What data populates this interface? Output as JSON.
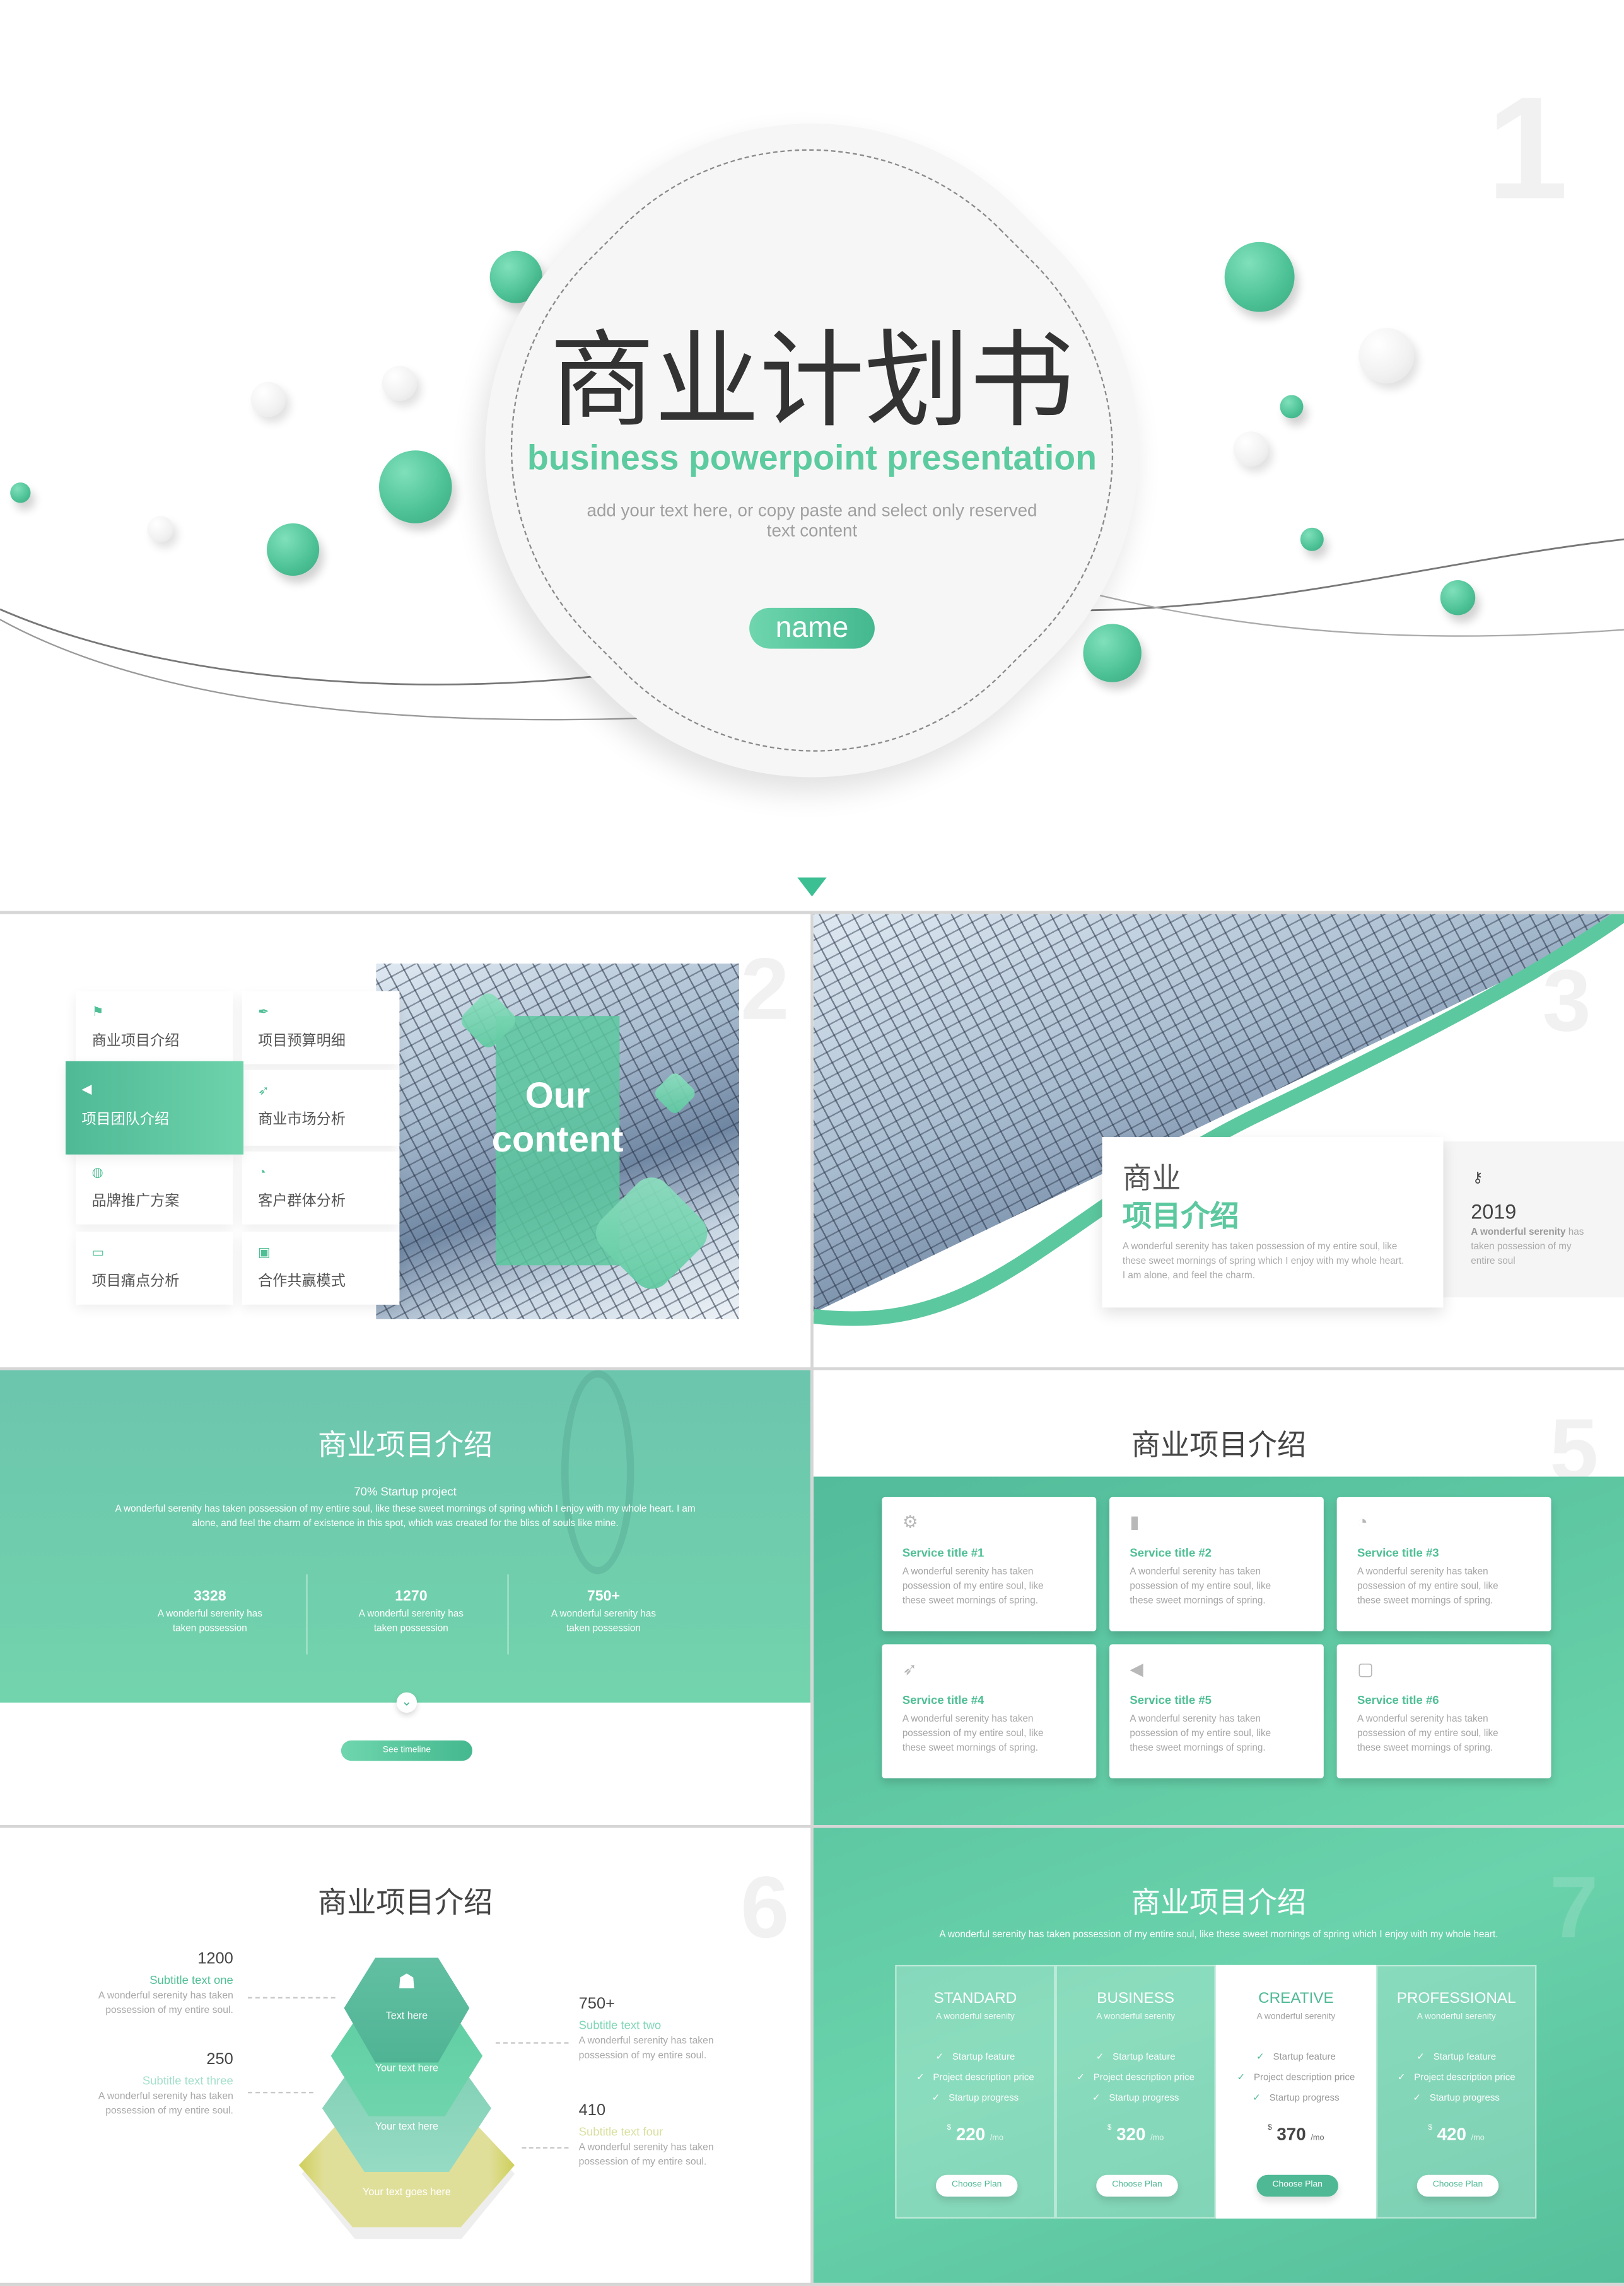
{
  "theme": {
    "accent": "#5cc89f",
    "accent_dark": "#4fb996",
    "yellow": "#e0df9a"
  },
  "slide1": {
    "title": "商业计划书",
    "subtitle": "business powerpoint presentation",
    "body_line1": "add your text here, or copy paste and select only reserved",
    "body_line2": "text content",
    "name_button": "name",
    "page_number": "1"
  },
  "slide2": {
    "page_number": "2",
    "overlay_title_1": "Our",
    "overlay_title_2": "content",
    "menu": [
      {
        "label": "商业项目介绍",
        "icon": "flag-icon"
      },
      {
        "label": "项目预算明细",
        "icon": "pen-icon"
      },
      {
        "label": "项目团队介绍",
        "icon": "megaphone-icon",
        "active": true
      },
      {
        "label": "商业市场分析",
        "icon": "rocket-icon"
      },
      {
        "label": "品牌推广方案",
        "icon": "globe-icon"
      },
      {
        "label": "客户群体分析",
        "icon": "pie-chart-icon"
      },
      {
        "label": "项目痛点分析",
        "icon": "credit-card-icon"
      },
      {
        "label": "合作共赢模式",
        "icon": "chart-icon"
      }
    ]
  },
  "slide3": {
    "page_number": "3",
    "title_1": "商业",
    "title_2": "项目介绍",
    "body": "A wonderful serenity has taken possession of my entire soul, like these sweet mornings of spring which I enjoy with my whole heart. I am alone, and feel the charm.",
    "year": "2019",
    "side_bold": "A wonderful serenity",
    "side_text": "has taken possession of my entire soul"
  },
  "slide4": {
    "title": "商业项目介绍",
    "tagline": "70% Startup project",
    "body": "A wonderful serenity has taken possession of my entire soul, like these sweet mornings of spring which I enjoy with my whole heart. I am alone, and feel the charm of existence in this spot, which was created for the bliss of souls like mine.",
    "stats": [
      {
        "value": "3328",
        "text": "A wonderful serenity has taken possession"
      },
      {
        "value": "1270",
        "text": "A wonderful serenity has taken possession"
      },
      {
        "value": "750+",
        "text": "A wonderful serenity has taken possession"
      }
    ],
    "button": "See timeline"
  },
  "slide5": {
    "title": "商业项目介绍",
    "page_number": "5",
    "services": [
      {
        "title": "Service title #1",
        "icon": "gear-icon",
        "text": "A wonderful serenity has taken possession of my entire soul, like these sweet mornings of spring."
      },
      {
        "title": "Service title #2",
        "icon": "book-icon",
        "text": "A wonderful serenity has taken possession of my entire soul, like these sweet mornings of spring."
      },
      {
        "title": "Service title #3",
        "icon": "pie-chart-icon",
        "text": "A wonderful serenity has taken possession of my entire soul, like these sweet mornings of spring."
      },
      {
        "title": "Service title #4",
        "icon": "rocket-icon",
        "text": "A wonderful serenity has taken possession of my entire soul, like these sweet mornings of spring."
      },
      {
        "title": "Service title #5",
        "icon": "megaphone-icon",
        "text": "A wonderful serenity has taken possession of my entire soul, like these sweet mornings of spring."
      },
      {
        "title": "Service title #6",
        "icon": "monitor-icon",
        "text": "A wonderful serenity has taken possession of my entire soul, like these sweet mornings of spring."
      }
    ]
  },
  "slide6": {
    "title": "商业项目介绍",
    "page_number": "6",
    "items": [
      {
        "value": "1200",
        "subtitle": "Subtitle text one",
        "text": "A wonderful serenity has taken possession of my entire soul.",
        "color": "#4fbf95"
      },
      {
        "value": "750+",
        "subtitle": "Subtitle text two",
        "text": "A wonderful serenity has taken possession of my entire soul.",
        "color": "#7fd6b6"
      },
      {
        "value": "250",
        "subtitle": "Subtitle text three",
        "text": "A wonderful serenity has taken possession of my entire soul.",
        "color": "#a3dfca"
      },
      {
        "value": "410",
        "subtitle": "Subtitle text four",
        "text": "A wonderful serenity has taken possession of my entire soul.",
        "color": "#d9df9c"
      }
    ],
    "hexagons": [
      "Text here",
      "Your text here",
      "Your text here",
      "Your text goes here"
    ]
  },
  "slide7": {
    "title": "商业项目介绍",
    "page_number": "7",
    "subtitle": "A wonderful serenity has taken possession of my entire soul, like these sweet mornings of spring which I enjoy with my whole heart.",
    "plans": [
      {
        "name": "STANDARD",
        "tagline": "A wonderful serenity",
        "features": [
          "Startup feature",
          "Project description price",
          "Startup progress"
        ],
        "currency": "$",
        "price": "220",
        "period": "/mo",
        "button": "Choose Plan"
      },
      {
        "name": "BUSINESS",
        "tagline": "A wonderful serenity",
        "features": [
          "Startup feature",
          "Project description price",
          "Startup progress"
        ],
        "currency": "$",
        "price": "320",
        "period": "/mo",
        "button": "Choose Plan"
      },
      {
        "name": "CREATIVE",
        "tagline": "A wonderful serenity",
        "features": [
          "Startup feature",
          "Project description price",
          "Startup progress"
        ],
        "currency": "$",
        "price": "370",
        "period": "/mo",
        "button": "Choose Plan",
        "highlighted": true
      },
      {
        "name": "PROFESSIONAL",
        "tagline": "A wonderful serenity",
        "features": [
          "Startup feature",
          "Project description price",
          "Startup progress"
        ],
        "currency": "$",
        "price": "420",
        "period": "/mo",
        "button": "Choose Plan"
      }
    ]
  }
}
